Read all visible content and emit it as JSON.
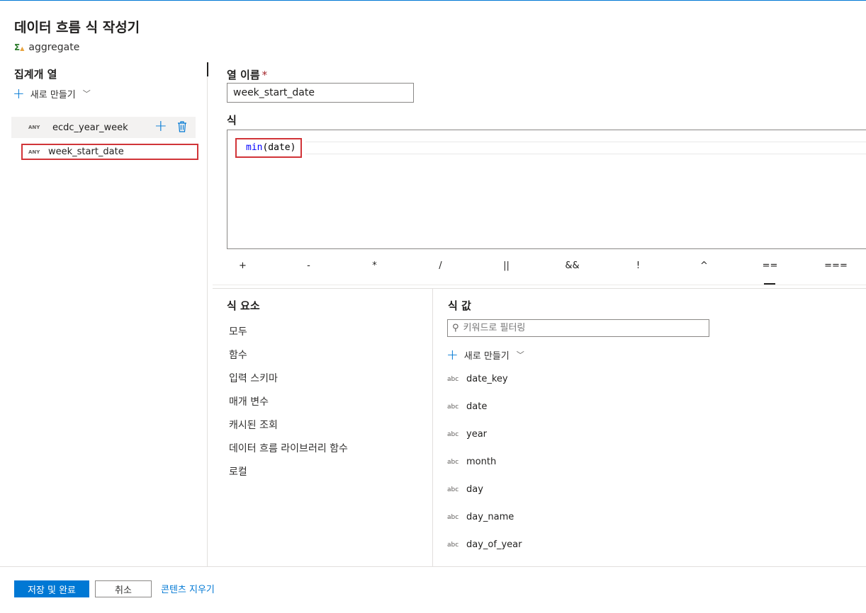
{
  "header": {
    "title": "데이터 흐름 식 작성기",
    "subtitle_icon": "sigma-aggregate-icon",
    "subtitle": "aggregate"
  },
  "left": {
    "heading": "집계개 열",
    "new_label": "새로 만들기",
    "columns": [
      {
        "type": "ANY",
        "name": "ecdc_year_week"
      },
      {
        "type": "ANY",
        "name": "week_start_date"
      }
    ]
  },
  "editor": {
    "column_name_label": "열 이름",
    "required_marker": "*",
    "column_name_value": "week_start_date",
    "expression_label": "식",
    "expression_fn": "min",
    "expression_args": "(date)"
  },
  "operators": [
    "+",
    "-",
    "*",
    "/",
    "||",
    "&&",
    "!",
    "^",
    "==",
    "==="
  ],
  "elements": {
    "heading": "식 요소",
    "items": [
      "모두",
      "함수",
      "입력 스키마",
      "매개 변수",
      "캐시된 조회",
      "데이터 흐름 라이브러리 함수",
      "로컬"
    ]
  },
  "values": {
    "heading": "식 값",
    "filter_placeholder": "키워드로 필터링",
    "new_label": "새로 만들기",
    "items": [
      {
        "type": "abc",
        "name": "date_key"
      },
      {
        "type": "abc",
        "name": "date"
      },
      {
        "type": "abc",
        "name": "year"
      },
      {
        "type": "abc",
        "name": "month"
      },
      {
        "type": "abc",
        "name": "day"
      },
      {
        "type": "abc",
        "name": "day_name"
      },
      {
        "type": "abc",
        "name": "day_of_year"
      }
    ]
  },
  "footer": {
    "save_label": "저장 및 완료",
    "cancel_label": "취소",
    "clear_label": "콘텐츠 지우기"
  },
  "colors": {
    "accent": "#0078d4",
    "highlight_border": "#d13438",
    "keyword": "#0000ff"
  }
}
